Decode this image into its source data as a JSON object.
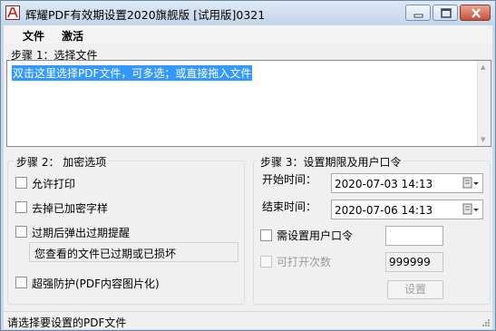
{
  "window": {
    "title": "辉耀PDF有效期设置2020旗舰版 [试用版]0321",
    "app_icon": "pdf-app-icon",
    "controls": {
      "minimize_icon": "minimize-icon",
      "maximize_icon": "maximize-icon",
      "close_icon": "close-icon"
    }
  },
  "menu": {
    "file": "文件",
    "activate": "激活"
  },
  "step1": {
    "label": "步骤 1：选择文件",
    "drop_text": "双击这里选择PDF文件，可多选；或直接拖入文件"
  },
  "step2": {
    "title": "步骤 2： 加密选项",
    "options": [
      {
        "label": "允许打印",
        "checked": false
      },
      {
        "label": "去掉已加密字样",
        "checked": false
      },
      {
        "label": "过期后弹出过期提醒",
        "checked": false
      }
    ],
    "expired_message": "您查看的文件已过期或已损坏",
    "super_protect": {
      "label": "超强防护(PDF内容图片化)",
      "checked": false
    }
  },
  "step3": {
    "title": "步骤 3：设置期限及用户口令",
    "start_label": "开始时间：",
    "start_value": "2020-07-03 14:13",
    "end_label": "结束时间：",
    "end_value": "2020-07-06 14:13",
    "calendar_icon": "calendar-dropdown-icon",
    "need_password": {
      "label": "需设置用户口令",
      "checked": false
    },
    "password_value": "",
    "open_count": {
      "label": "可打开次数",
      "checked": false,
      "enabled": false
    },
    "open_count_value": "999999",
    "set_button": "设置"
  },
  "status": {
    "text": "请选择要设置的PDF文件"
  },
  "colors": {
    "selection": "#3399ff",
    "title_gradient_top": "#dfe9f6",
    "close_button": "#c6533a"
  }
}
